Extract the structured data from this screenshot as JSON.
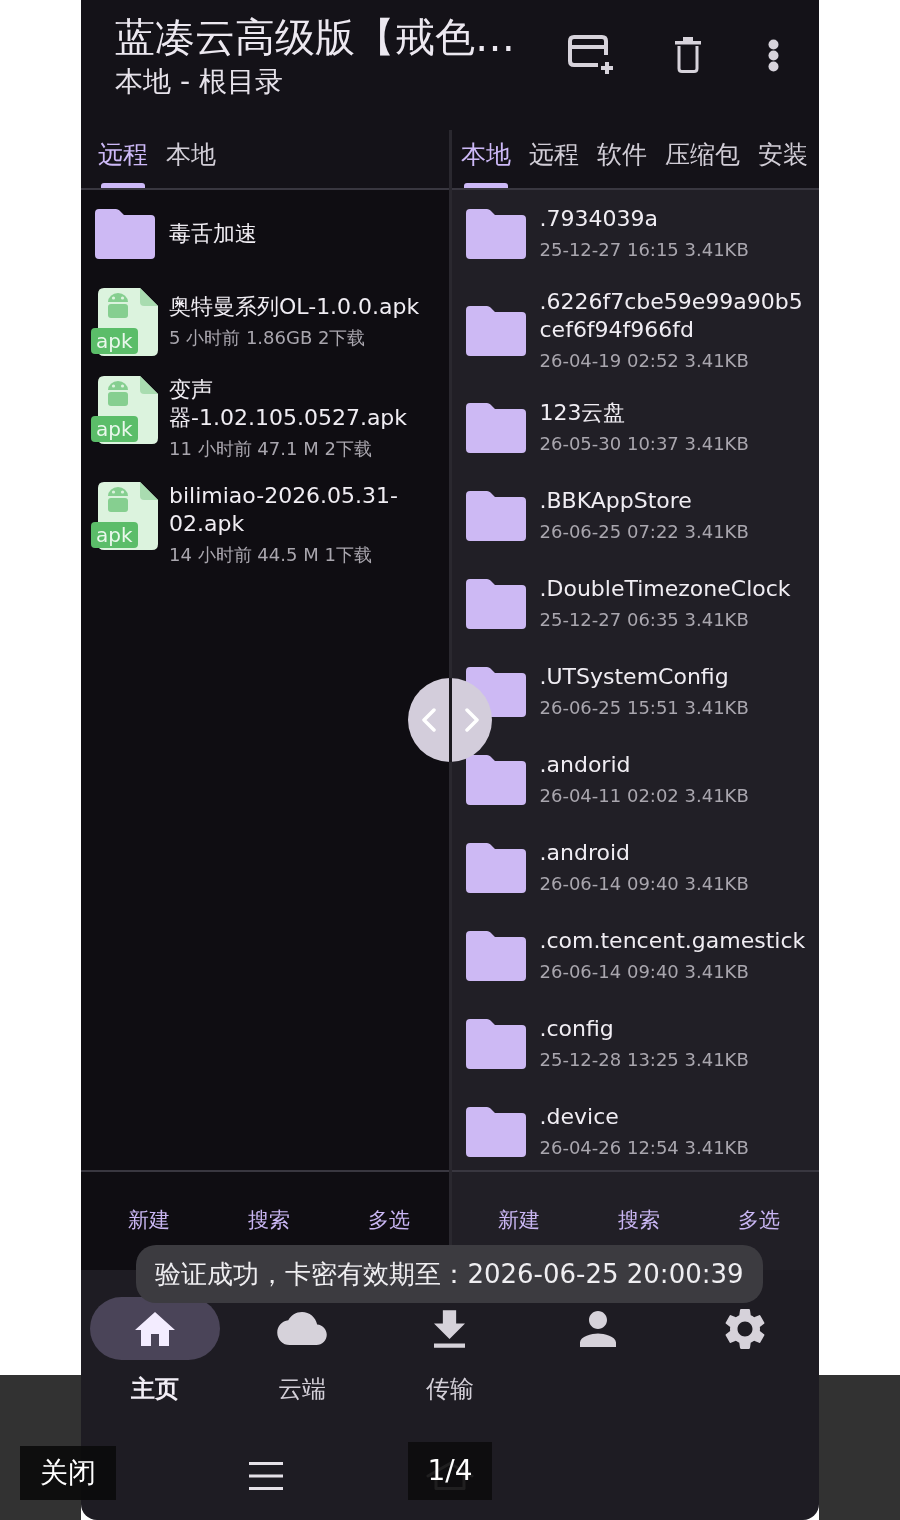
{
  "app_bar": {
    "title": "蓝凑云高级版【戒色…",
    "subtitle": "本地 - 根目录"
  },
  "panes": [
    {
      "focused": false,
      "tabs": [
        {
          "label": "远程",
          "selected": true
        },
        {
          "label": "本地",
          "selected": false
        }
      ],
      "files": [
        {
          "kind": "folder",
          "name": "毒舌加速"
        },
        {
          "kind": "apk",
          "name": "奥特曼系列OL-1.0.0.apk",
          "badge": "apk",
          "details": "5 小时前 1.86GB 2下载"
        },
        {
          "kind": "apk",
          "name": "变声器-1.02.105.0527.apk",
          "badge": "apk",
          "details": "11 小时前 47.1 M 2下载"
        },
        {
          "kind": "apk",
          "name": "bilimiao-2026.05.31-02.apk",
          "badge": "apk",
          "details": "14 小时前 44.5 M 1下载"
        }
      ],
      "actions": [
        "新建",
        "搜索",
        "多选"
      ]
    },
    {
      "focused": true,
      "tabs": [
        {
          "label": "本地",
          "selected": true
        },
        {
          "label": "远程",
          "selected": false
        },
        {
          "label": "软件",
          "selected": false
        },
        {
          "label": "压缩包",
          "selected": false
        },
        {
          "label": "安装",
          "selected": false
        }
      ],
      "files": [
        {
          "kind": "folder",
          "name": ".7934039a",
          "details": "25-12-27 16:15 3.41KB"
        },
        {
          "kind": "folder",
          "name": ".6226f7cbe59e99a90b5cef6f94f966fd",
          "details": "26-04-19 02:52 3.41KB"
        },
        {
          "kind": "folder",
          "name": "123云盘",
          "details": "26-05-30 10:37 3.41KB"
        },
        {
          "kind": "folder",
          "name": ".BBKAppStore",
          "details": "26-06-25 07:22 3.41KB"
        },
        {
          "kind": "folder",
          "name": ".DoubleTimezoneClock",
          "details": "25-12-27 06:35 3.41KB"
        },
        {
          "kind": "folder",
          "name": ".UTSystemConfig",
          "details": "26-06-25 15:51 3.41KB"
        },
        {
          "kind": "folder",
          "name": ".andorid",
          "details": "26-04-11 02:02 3.41KB"
        },
        {
          "kind": "folder",
          "name": ".android",
          "details": "26-06-14 09:40 3.41KB"
        },
        {
          "kind": "folder",
          "name": ".com.tencent.gamestick",
          "details": "26-06-14 09:40 3.41KB"
        },
        {
          "kind": "folder",
          "name": ".config",
          "details": "25-12-28 13:25 3.41KB"
        },
        {
          "kind": "folder",
          "name": ".device",
          "details": "26-04-26 12:54 3.41KB"
        }
      ],
      "actions": [
        "新建",
        "搜索",
        "多选"
      ]
    }
  ],
  "toast": "验证成功，卡密有效期至：2026-06-25 20:00:39",
  "bottom_nav": [
    {
      "kind": "home",
      "label": "主页",
      "selected": true
    },
    {
      "kind": "cloud",
      "label": "云端",
      "selected": false
    },
    {
      "kind": "download",
      "label": "传输",
      "selected": false
    },
    {
      "kind": "person",
      "selected": false
    },
    {
      "kind": "settings",
      "selected": false
    }
  ],
  "viewer": {
    "close_button": "关闭",
    "page_counter": "1/4"
  }
}
